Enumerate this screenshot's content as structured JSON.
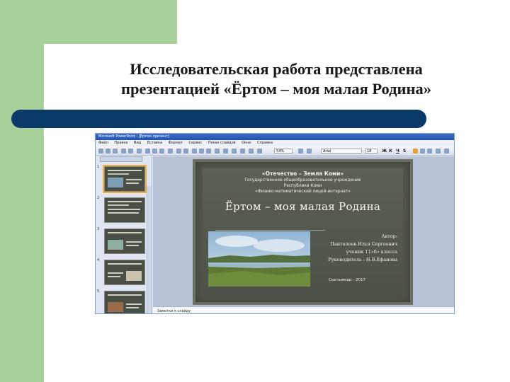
{
  "slide": {
    "title_line1": "Исследовательская  работа представлена",
    "title_line2": "презентацией  «Ёртом – моя малая Родина»"
  },
  "powerpoint": {
    "window_title": "Microsoft PowerPoint - [Ёртом презент]",
    "menu": [
      "Файл",
      "Правка",
      "Вид",
      "Вставка",
      "Формат",
      "Сервис",
      "Показ слайдов",
      "Окно",
      "Справка"
    ],
    "zoom": "54%",
    "font_name": "Arial",
    "font_size": "18",
    "format_buttons": [
      "Ж",
      "К",
      "Ч",
      "S"
    ],
    "thumbnail_numbers": [
      "1",
      "2",
      "3",
      "4",
      "5"
    ],
    "notes_placeholder": "Заметки к слайду"
  },
  "inner_slide": {
    "line1": "«Отечество – Земля Коми»",
    "line2": "Государственное общеобразовательное учреждение",
    "line3": "Республики Коми",
    "line4": "«Физико-математический лицей-интернат»",
    "main_title": "Ёртом – моя малая Родина",
    "author_label": "Автор:",
    "author_name": "Пантелеев Илья Сергеевич",
    "author_class": "ученик 11«б» класса",
    "supervisor": "Руководитель : Н.В.Ефанова",
    "city_year": "Сыктывкар - 2017"
  },
  "colors": {
    "green": "#a9cf9a",
    "navy_bar": "#0a3a68"
  }
}
